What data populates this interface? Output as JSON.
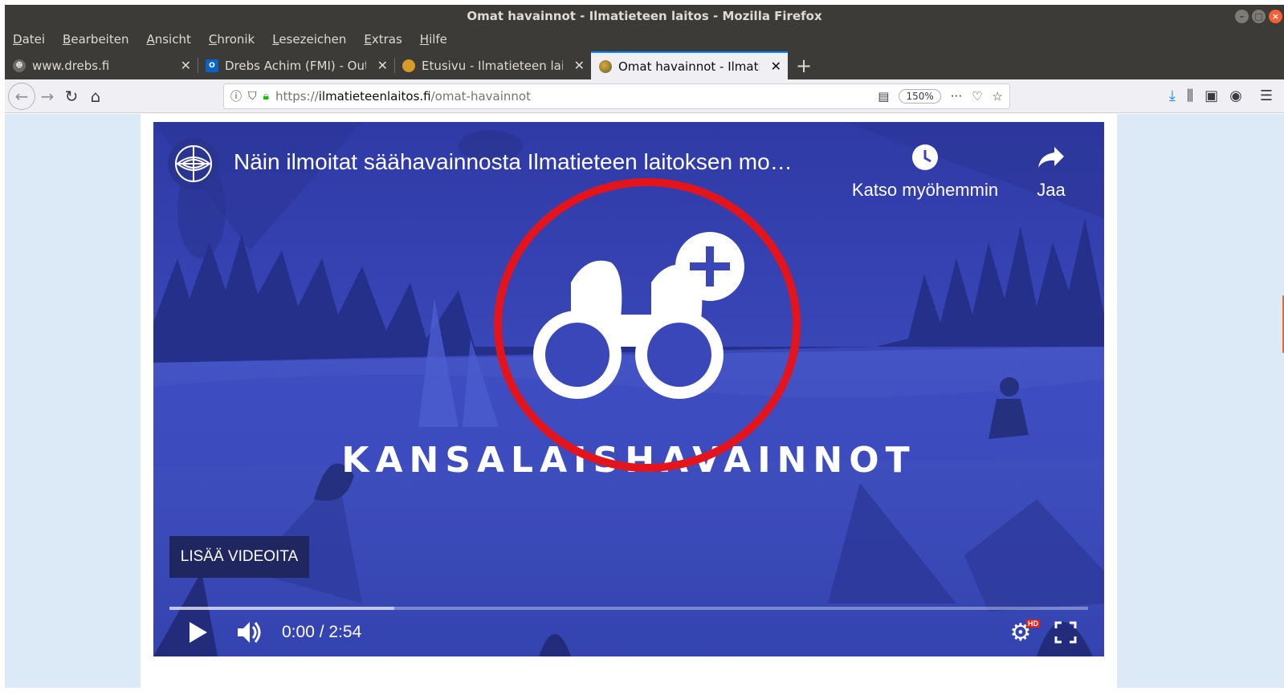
{
  "window": {
    "title": "Omat havainnot - Ilmatieteen laitos - Mozilla Firefox"
  },
  "menu": [
    "Datei",
    "Bearbeiten",
    "Ansicht",
    "Chronik",
    "Lesezeichen",
    "Extras",
    "Hilfe"
  ],
  "tabs": [
    {
      "label": "www.drebs.fi",
      "favicon": "person-icon",
      "active": false
    },
    {
      "label": "Drebs Achim (FMI) - Outl",
      "favicon": "outlook-icon",
      "active": false
    },
    {
      "label": "Etusivu - Ilmatieteen lait",
      "favicon": "fmi-icon",
      "active": false
    },
    {
      "label": "Omat havainnot - Ilmatie",
      "favicon": "globe-icon",
      "active": true
    }
  ],
  "navbar": {
    "url_scheme": "https://",
    "url_host": "ilmatieteenlaitos.fi",
    "url_path": "/omat-havainnot",
    "zoom": "150%"
  },
  "video": {
    "title": "Näin ilmoitat säähavainnosta Ilmatieteen laitoksen mo…",
    "watch_later": "Katso myöhemmin",
    "share": "Jaa",
    "brand_text": "KANSALAISHAVAINNOT",
    "more_videos": "LISÄÄ VIDEOITA",
    "time": "0:00 / 2:54",
    "buffered_fraction": 0.245,
    "played_fraction": 0.0,
    "hd_badge": "HD"
  },
  "colors": {
    "page_bg": "#dbeaf6",
    "video_bg": "#3a47b8",
    "annotation_circle": "#e3141c",
    "active_tab_accent": "#0a84ff"
  }
}
